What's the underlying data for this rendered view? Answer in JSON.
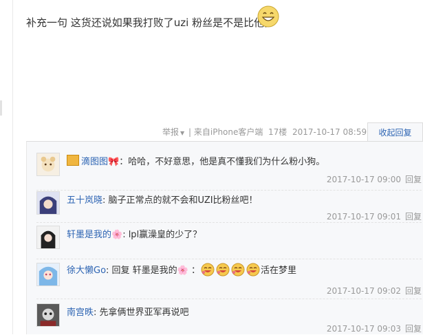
{
  "post": {
    "text": "补充一句 这货还说如果我打败了uzi 粉丝是不是比他多",
    "emoji": "grinning-face-icon"
  },
  "meta": {
    "report": "举报",
    "sep": "|",
    "client": "来自iPhone客户端",
    "floor": "17楼",
    "time": "2017-10-17 08:59",
    "collapse_label": "收起回复"
  },
  "replies": [
    {
      "user": "滴图图🎀",
      "text": "：哈哈，不好意思，他是真不懂我们为什么粉小狗。",
      "time": "2017-10-17 09:00",
      "reply_label": "回复"
    },
    {
      "user": "五十岚晓",
      "text": ": 脑子正常点的就不会和UZI比粉丝吧！",
      "time": "2017-10-17 09:01",
      "reply_label": "回复"
    },
    {
      "user": "轩墨是我的🌸",
      "text": ": lpl赢澡皇的少了？",
      "time": "2017-10-17 09:01",
      "reply_label": "回复"
    },
    {
      "user": "徐大懒Go",
      "text_prefix": ": 回复 轩墨是我的🌸 ：",
      "text_suffix": "活在梦里",
      "time": "2017-10-17 09:02",
      "reply_label": "回复"
    },
    {
      "user": "南宫昳",
      "text": ": 先拿俩世界亚军再说吧",
      "time": "2017-10-17 09:03",
      "reply_label": "回复"
    }
  ],
  "colors": {
    "link": "#2d64b3",
    "muted": "#999999",
    "panel": "#f7f8fa"
  }
}
